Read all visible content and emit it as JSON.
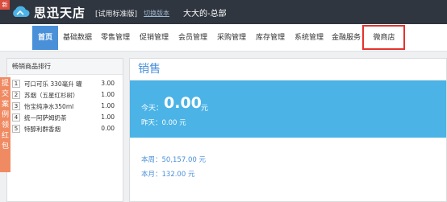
{
  "header": {
    "new_badge": "新",
    "logo_text": "思迅天店",
    "edition": "[试用标准版]",
    "switch_link": "切换版本",
    "store_name": "大大的-总部"
  },
  "nav": {
    "items": [
      {
        "label": "首页"
      },
      {
        "label": "基础数据"
      },
      {
        "label": "零售管理"
      },
      {
        "label": "促销管理"
      },
      {
        "label": "会员管理"
      },
      {
        "label": "采购管理"
      },
      {
        "label": "库存管理"
      },
      {
        "label": "系统管理"
      },
      {
        "label": "金融服务"
      },
      {
        "label": "微商店"
      }
    ],
    "active_index": 0,
    "highlight_color": "#e5322d",
    "active_color": "#4a90d9"
  },
  "ranking": {
    "title": "畅销商品排行",
    "rows": [
      {
        "rank": "1",
        "name": "可口可乐 330毫升 罐",
        "value": "3.00"
      },
      {
        "rank": "2",
        "name": "苏烟（五星红杉树）",
        "value": "1.00"
      },
      {
        "rank": "3",
        "name": "怡宝纯净水350ml",
        "value": "1.00"
      },
      {
        "rank": "4",
        "name": "统一阿萨姆奶茶",
        "value": "1.00"
      },
      {
        "rank": "5",
        "name": "特醇利群香烟",
        "value": "0.00"
      }
    ]
  },
  "promo": {
    "text": "提交案例领红包",
    "color": "#f08a62"
  },
  "sales": {
    "title": "销售",
    "today_label": "今天：",
    "today_value": "0.00",
    "today_unit": "元",
    "yesterday": "昨天：0.00 元",
    "week": "本周：50,157.00 元",
    "month": "本月：132.00 元",
    "box_color": "#4bb3e6"
  }
}
